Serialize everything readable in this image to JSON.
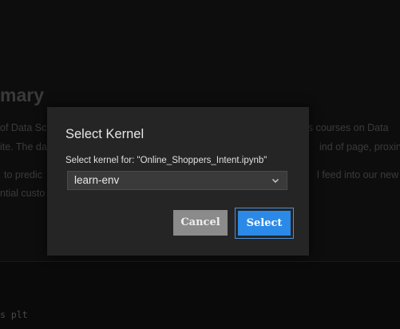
{
  "background": {
    "heading": "mary",
    "lines": [
      "of Data Sc",
      "ls courses on Data",
      "ite. The da",
      "ind of page, proxin",
      "to predic",
      "l feed into our new",
      "ntial custo"
    ],
    "code": "s plt"
  },
  "dialog": {
    "title": "Select Kernel",
    "label": "Select kernel for: \"Online_Shoppers_Intent.ipynb\"",
    "selected_kernel": "learn-env",
    "cancel_label": "Cancel",
    "select_label": "Select"
  },
  "colors": {
    "dialog_bg": "#252526",
    "primary_button": "#2b8ae8",
    "cancel_button": "#8b8b8b",
    "focus_ring": "#4b8fd9"
  },
  "icons": {
    "dropdown": "chevron-down-icon"
  }
}
